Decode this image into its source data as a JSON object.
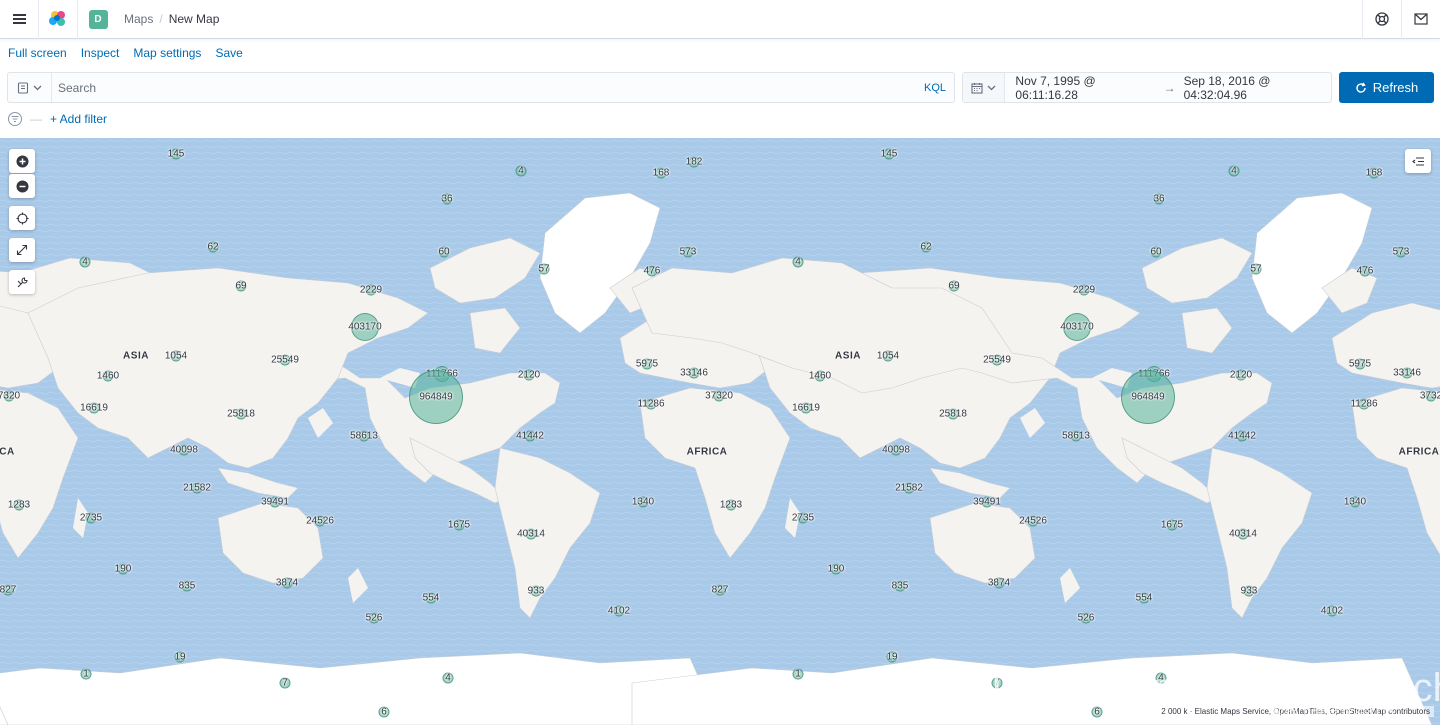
{
  "header": {
    "space_initial": "D",
    "breadcrumb_root": "Maps",
    "breadcrumb_current": "New Map"
  },
  "topnav": {
    "full_screen": "Full screen",
    "inspect": "Inspect",
    "map_settings": "Map settings",
    "save": "Save"
  },
  "query": {
    "placeholder": "Search",
    "language": "KQL"
  },
  "time": {
    "start": "Nov 7, 1995 @ 06:11:16.28",
    "arrow": "→",
    "end": "Sep 18, 2016 @ 04:32:04.96"
  },
  "refresh_label": "Refresh",
  "filter": {
    "dash": "—",
    "add_filter": "+ Add filter"
  },
  "colors": {
    "accent": "#006bb4",
    "cluster": "#54b399",
    "ocean": "#a8c8e8",
    "land": "#f5f3ef"
  },
  "map": {
    "continents": [
      "ASIA",
      "AFRICA",
      "ASIA",
      "CA",
      "AFRICA"
    ],
    "clusters": [
      "145",
      "182",
      "168",
      "4",
      "36",
      "62",
      "60",
      "57",
      "476",
      "573",
      "4",
      "69",
      "2229",
      "403170",
      "1054",
      "25549",
      "111766",
      "2120",
      "5975",
      "33146",
      "1460",
      "16619",
      "25818",
      "964849",
      "37320",
      "11286",
      "58613",
      "41442",
      "7320",
      "40098",
      "21582",
      "1340",
      "1283",
      "39491",
      "2735",
      "24526",
      "1675",
      "40314",
      "190",
      "835",
      "3874",
      "554",
      "933",
      "827",
      "4102",
      "526",
      "1",
      "19",
      "7",
      "4",
      "6",
      "145",
      "168",
      "4",
      "36",
      "62",
      "60",
      "573",
      "476",
      "57",
      "4",
      "69",
      "2229",
      "403170",
      "1054",
      "25549",
      "111766",
      "2120",
      "5975",
      "33146",
      "1460",
      "16619",
      "25818",
      "964849",
      "3732",
      "11286",
      "58613",
      "41442",
      "40098",
      "21582",
      "1340",
      "1283",
      "39491",
      "2735",
      "24526",
      "1675",
      "40314",
      "190",
      "835",
      "3874",
      "554",
      "933",
      "827",
      "4102",
      "526",
      "1",
      "19",
      "7",
      "4",
      "6"
    ],
    "attribution": "Elastic Maps Service, OpenMapTiles, OpenStreetMap contributors",
    "scale": "2 000 k"
  },
  "watermark": "https://blog.csdn.net/UbuntuTouch",
  "watermark_tag": "@稀土掘金技术社区"
}
